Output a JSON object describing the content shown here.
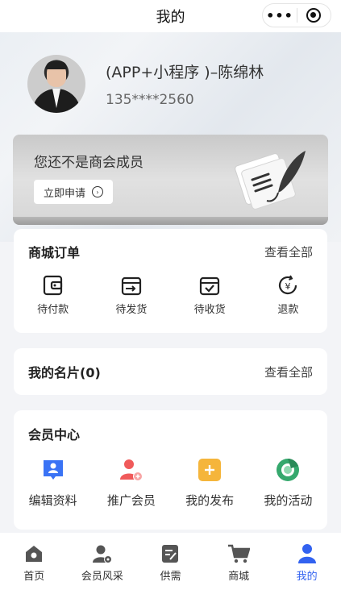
{
  "nav": {
    "title": "我的",
    "more_label": "•••"
  },
  "profile": {
    "name": "(APP+小程序 )–陈绵林",
    "phone": "135****2560"
  },
  "member_banner": {
    "title": "您还不是商会成员",
    "apply_label": "立即申请"
  },
  "orders": {
    "title": "商城订单",
    "view_all": "查看全部",
    "items": [
      {
        "label": "待付款",
        "icon": "wallet-icon"
      },
      {
        "label": "待发货",
        "icon": "ship-box-icon"
      },
      {
        "label": "待收货",
        "icon": "receive-box-icon"
      },
      {
        "label": "退款",
        "icon": "refund-icon"
      }
    ]
  },
  "cards": {
    "title": "我的名片(0)",
    "view_all": "查看全部"
  },
  "member_center": {
    "title": "会员中心",
    "items": [
      {
        "label": "编辑资料",
        "icon": "edit-profile-icon",
        "color": "#3a73f5"
      },
      {
        "label": "推广会员",
        "icon": "promote-member-icon",
        "color": "#f05a5a"
      },
      {
        "label": "我的发布",
        "icon": "my-post-icon",
        "color": "#f5b53b"
      },
      {
        "label": "我的活动",
        "icon": "my-activity-icon",
        "color": "#35a86d"
      }
    ]
  },
  "tabbar": {
    "active_color": "#3262f0",
    "items": [
      {
        "label": "首页",
        "icon": "home-icon"
      },
      {
        "label": "会员风采",
        "icon": "member-showcase-icon"
      },
      {
        "label": "供需",
        "icon": "supply-demand-icon"
      },
      {
        "label": "商城",
        "icon": "cart-icon"
      },
      {
        "label": "我的",
        "icon": "profile-icon",
        "active": true
      }
    ]
  }
}
